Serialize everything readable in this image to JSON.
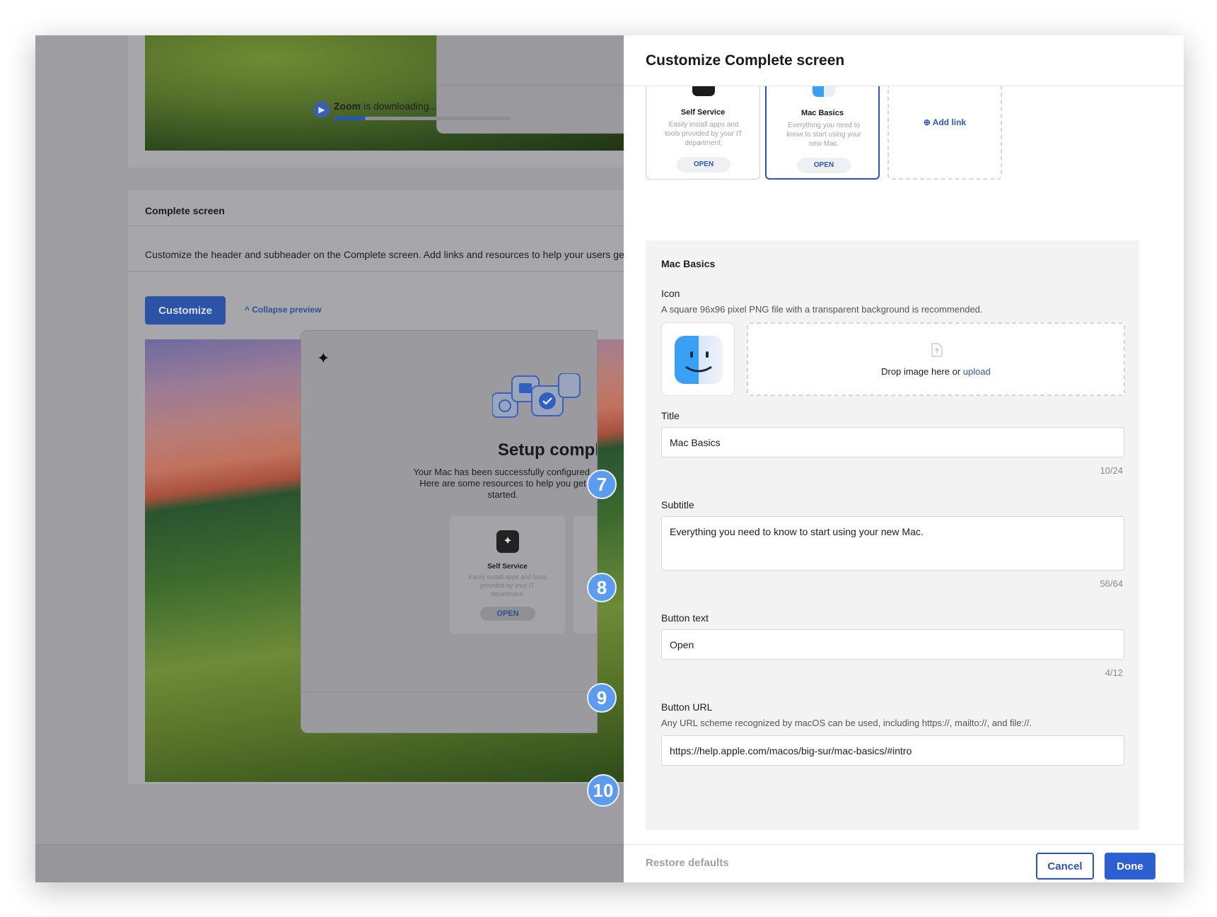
{
  "background_page": {
    "download": {
      "app": "Zoom",
      "status": " is downloading...",
      "icon": "zoom-icon",
      "progress": 0.18
    },
    "complete_screen": {
      "title": "Complete screen",
      "description": "Customize the header and subheader on the Complete screen. Add links and resources to help your users get started.",
      "customize_label": "Customize",
      "collapse_label": "Collapse preview"
    },
    "preview": {
      "heading": "Setup complete",
      "body": "Your Mac has been successfully configured. Here are some resources to help you get started.",
      "tile": {
        "title": "Self Service",
        "description": "Easily install apps and tools provided by your IT department.",
        "button": "OPEN"
      }
    }
  },
  "markers": [
    "7",
    "8",
    "9",
    "10"
  ],
  "panel": {
    "title": "Customize Complete screen",
    "links": [
      {
        "title": "Self Service",
        "description": "Easily install apps and tools provided by your IT department.",
        "button": "OPEN",
        "icon": "self-service-icon"
      },
      {
        "title": "Mac Basics",
        "description": "Everything you need to know to start using your new Mac.",
        "button": "OPEN",
        "icon": "finder-icon",
        "selected": true
      }
    ],
    "add_link_label": "Add link",
    "detail": {
      "heading": "Mac Basics",
      "icon_label": "Icon",
      "icon_hint": "A square 96x96 pixel PNG file with a transparent background is recommended.",
      "drop_text": "Drop image here or ",
      "upload_label": "upload",
      "title_label": "Title",
      "title_value": "Mac Basics",
      "title_count": "10/24",
      "subtitle_label": "Subtitle",
      "subtitle_value": "Everything you need to know to start using your new Mac.",
      "subtitle_count": "56/64",
      "button_text_label": "Button text",
      "button_text_value": "Open",
      "button_text_count": "4/12",
      "button_url_label": "Button URL",
      "button_url_hint": "Any URL scheme recognized by macOS can be used, including https://, mailto://, and file://.",
      "button_url_value": "https://help.apple.com/macos/big-sur/mac-basics/#intro"
    },
    "footer": {
      "restore_label": "Restore defaults",
      "cancel_label": "Cancel",
      "done_label": "Done"
    }
  },
  "colors": {
    "accent": "#2c55b0",
    "marker": "#5b9cf0",
    "overlay": "#9c9ca1"
  }
}
